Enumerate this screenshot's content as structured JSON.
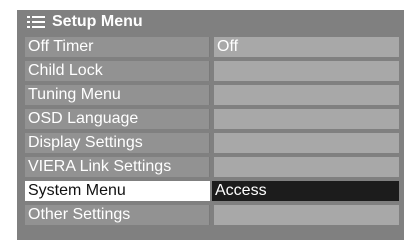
{
  "menu": {
    "title": "Setup Menu",
    "icon": "menu-list-icon",
    "rows": [
      {
        "label": "Off Timer",
        "value": "Off"
      },
      {
        "label": "Child Lock",
        "value": ""
      },
      {
        "label": "Tuning Menu",
        "value": ""
      },
      {
        "label": "OSD Language",
        "value": ""
      },
      {
        "label": "Display Settings",
        "value": ""
      },
      {
        "label": "VIERA Link Settings",
        "value": ""
      },
      {
        "label": "System Menu",
        "value": "Access"
      },
      {
        "label": "Other Settings",
        "value": ""
      }
    ],
    "selected_index": 6
  },
  "colors": {
    "panel": "#808080",
    "selected_label_bg": "#ffffff",
    "selected_value_bg": "#1c1c1c"
  }
}
